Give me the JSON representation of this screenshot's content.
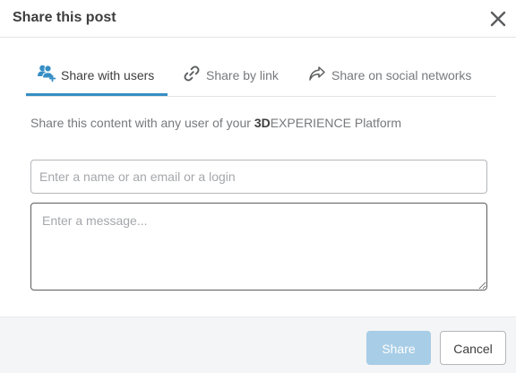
{
  "dialog": {
    "title": "Share this post"
  },
  "tabs": [
    {
      "label": "Share with users",
      "icon": "add-user-icon",
      "active": true
    },
    {
      "label": "Share by link",
      "icon": "link-icon",
      "active": false
    },
    {
      "label": "Share on social networks",
      "icon": "share-arrow-icon",
      "active": false
    }
  ],
  "description": {
    "prefix": "Share this content with any user of your ",
    "brand_bold": "3D",
    "brand_rest": "EXPERIENCE Platform"
  },
  "form": {
    "recipient_placeholder": "Enter a name or an email or a login",
    "recipient_value": "",
    "message_placeholder": "Enter a message...",
    "message_value": ""
  },
  "footer": {
    "share_label": "Share",
    "cancel_label": "Cancel"
  },
  "colors": {
    "accent": "#368ec4",
    "share_disabled": "#a8cde6",
    "footer_bg": "#f4f5f6",
    "text_dark": "#3d3d3d",
    "text_muted": "#77797c"
  }
}
